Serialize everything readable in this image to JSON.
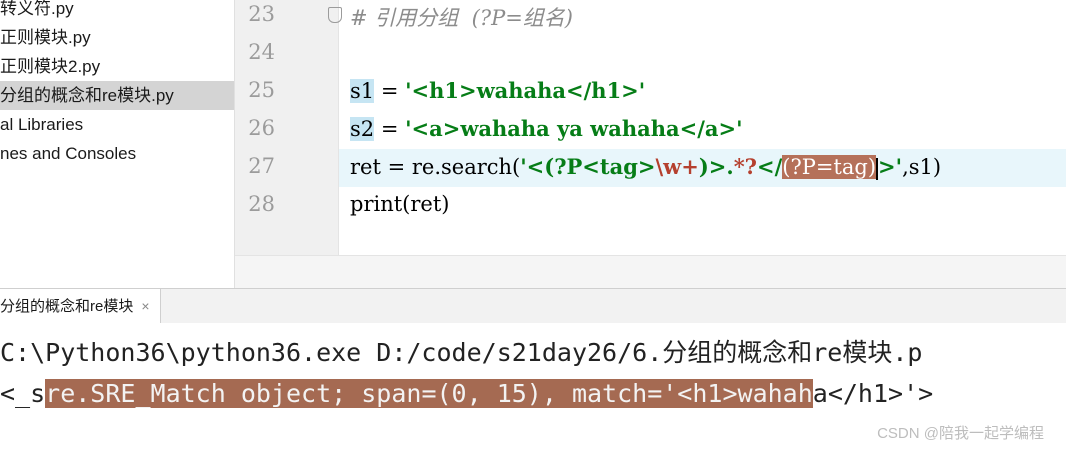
{
  "project_tree": {
    "items": [
      {
        "label": "转义符.py",
        "selected": false
      },
      {
        "label": "正则模块.py",
        "selected": false
      },
      {
        "label": "正则模块2.py",
        "selected": false
      },
      {
        "label": "分组的概念和re模块.py",
        "selected": true
      },
      {
        "label": "al Libraries",
        "selected": false
      },
      {
        "label": "nes and Consoles",
        "selected": false
      }
    ]
  },
  "editor": {
    "line_numbers": [
      "23",
      "24",
      "25",
      "26",
      "27",
      "28"
    ],
    "line23": "# 引用分组  (?P=组名)",
    "line25_var": "s1",
    "line25_rest": " = ",
    "line25_str": "'<h1>wahaha</h1>'",
    "line26_var": "s2",
    "line26_rest": " = ",
    "line26_str": "'<a>wahaha ya wahaha</a>'",
    "line27_a": "ret = re.search(",
    "line27_b": "'<(?P<tag>",
    "line27_c": "\\w+",
    "line27_d": ")>.",
    "line27_e": "*?",
    "line27_f": "</",
    "line27_g": "(?P=tag)",
    "line27_h": ">'",
    "line27_i": ",s1)",
    "line28": "print(ret)"
  },
  "run_tab": {
    "label": "分组的概念和re模块",
    "close": "×"
  },
  "console": {
    "line1": "C:\\Python36\\python36.exe D:/code/s21day26/6.分组的概念和re模块.p",
    "line2_pre": "<_s",
    "line2_hl": "re.SRE_Match object; span=(0, 15), match='<h1>wahah",
    "line2_post": "a</h1>'>"
  },
  "watermark": "CSDN @陪我一起学编程"
}
